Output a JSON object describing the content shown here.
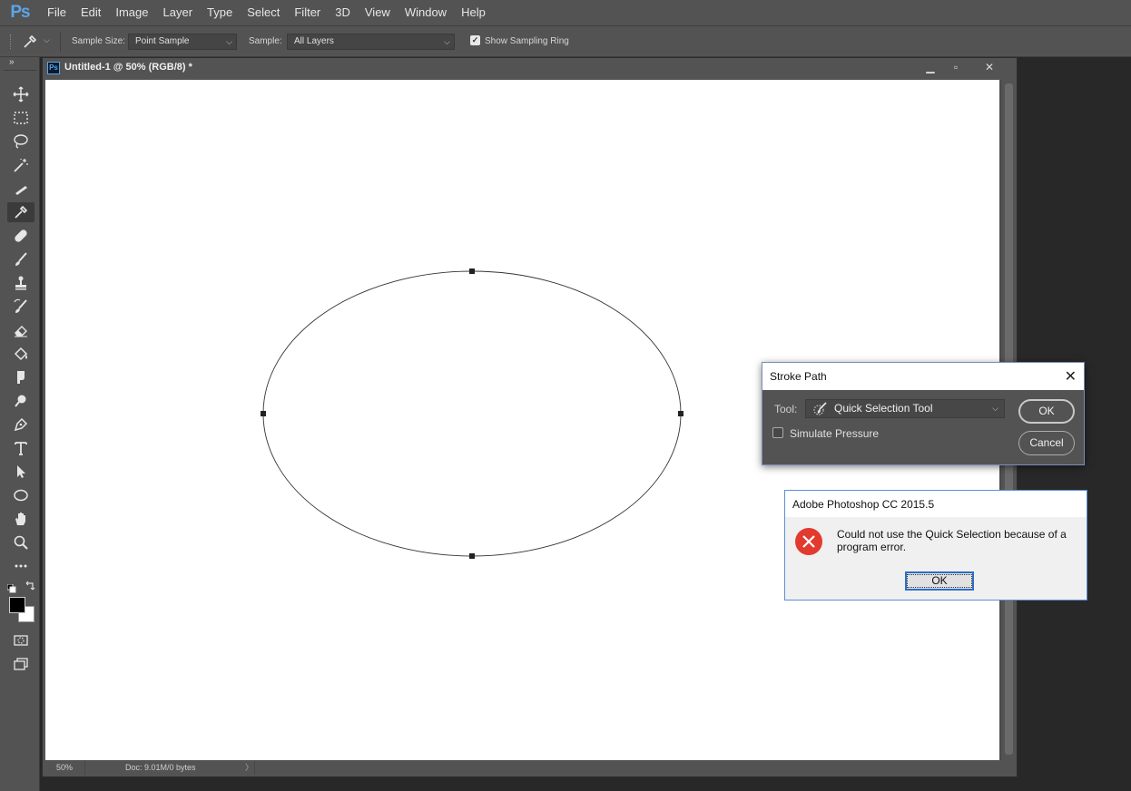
{
  "app": {
    "logo": "Ps"
  },
  "menu": [
    "File",
    "Edit",
    "Image",
    "Layer",
    "Type",
    "Select",
    "Filter",
    "3D",
    "View",
    "Window",
    "Help"
  ],
  "options": {
    "sample_size_label": "Sample Size:",
    "sample_size_value": "Point Sample",
    "sample_label": "Sample:",
    "sample_value": "All Layers",
    "show_sampling_ring_checked": true,
    "show_sampling_ring_label": "Show Sampling Ring"
  },
  "toolbar": {
    "collapse_glyph": "»",
    "tools": [
      "move-tool",
      "marquee-tool",
      "lasso-tool",
      "magic-wand-tool",
      "crop-tool",
      "eyedropper-tool",
      "healing-brush-tool",
      "brush-tool",
      "clone-stamp-tool",
      "history-brush-tool",
      "eraser-tool",
      "paint-bucket-tool",
      "smudge-tool",
      "dodge-tool",
      "pen-tool",
      "type-tool",
      "path-selection-tool",
      "ellipse-tool",
      "hand-tool",
      "zoom-tool",
      "edit-toolbar"
    ],
    "active_tool": "eyedropper-tool",
    "foreground_color": "#000000",
    "background_color": "#ffffff"
  },
  "document": {
    "tab_icon": "Ps",
    "title": "Untitled-1 @ 50% (RGB/8) *",
    "zoom": "50%",
    "doc_info": "Doc: 9.01M/0 bytes",
    "status_arrow": "〉"
  },
  "stroke_dialog": {
    "title": "Stroke Path",
    "close_glyph": "✕",
    "tool_label": "Tool:",
    "tool_value": "Quick Selection Tool",
    "simulate_pressure_label": "Simulate Pressure",
    "simulate_pressure_checked": false,
    "ok_label": "OK",
    "cancel_label": "Cancel"
  },
  "error_dialog": {
    "title": "Adobe Photoshop CC 2015.5",
    "message": "Could not use the Quick Selection because of a program error.",
    "ok_label": "OK",
    "icon": "error-icon"
  },
  "colors": {
    "ui_panel": "#535353",
    "ui_dark": "#282828",
    "ps_blue": "#5aa6e8",
    "error_red": "#e23a2f",
    "dialog_focus": "#2a6fc9"
  }
}
